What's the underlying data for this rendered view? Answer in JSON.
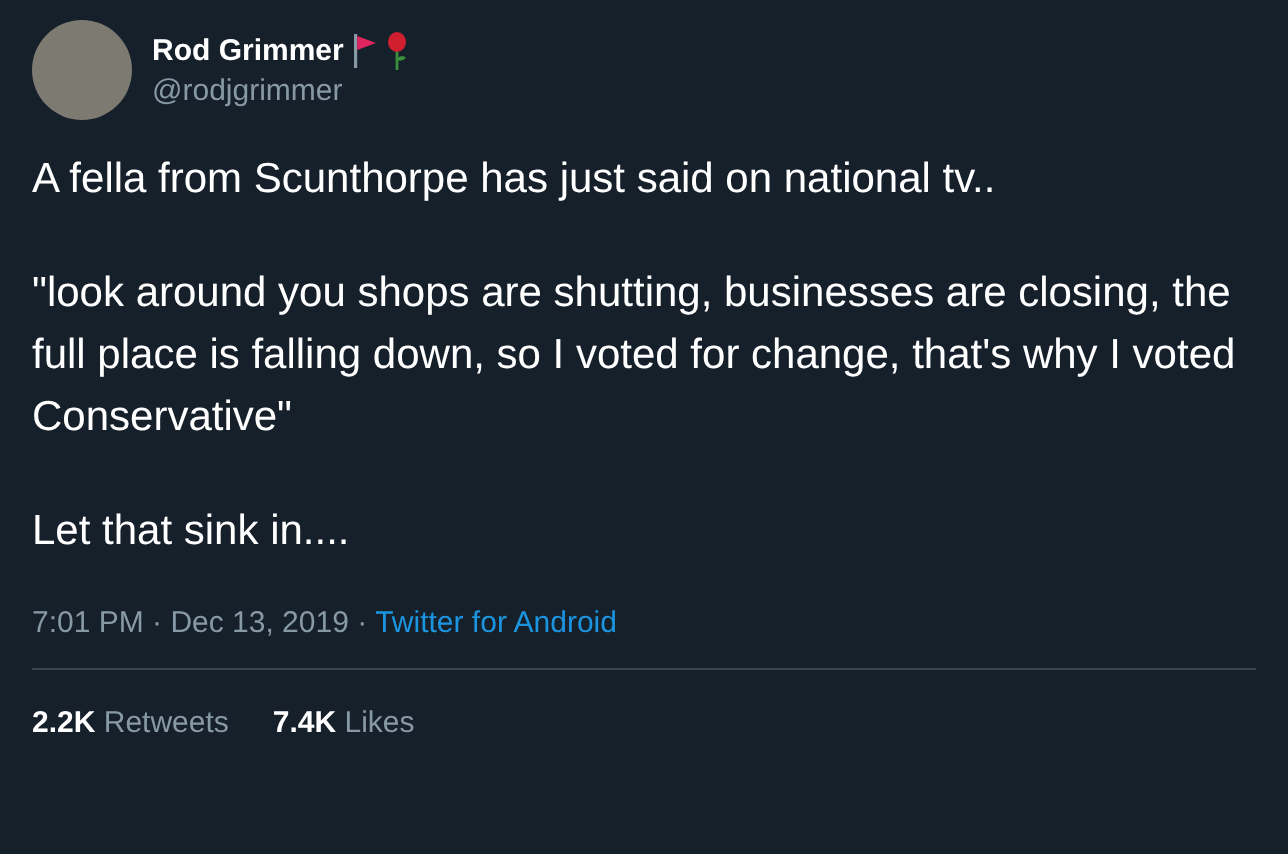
{
  "author": {
    "name": "Rod Grimmer",
    "handle": "@rodjgrimmer"
  },
  "paragraphs": [
    "A fella from Scunthorpe has just said on national tv..",
    "\"look around you shops are shutting, businesses are closing, the full place is falling down, so I voted for change, that's why I voted Conservative\"",
    "Let that sink in...."
  ],
  "meta": {
    "timestamp": "7:01 PM · Dec 13, 2019 ·",
    "source": "Twitter for Android"
  },
  "stats": [
    {
      "count": "2.2K",
      "label": "Retweets"
    },
    {
      "count": "7.4K",
      "label": "Likes"
    }
  ]
}
